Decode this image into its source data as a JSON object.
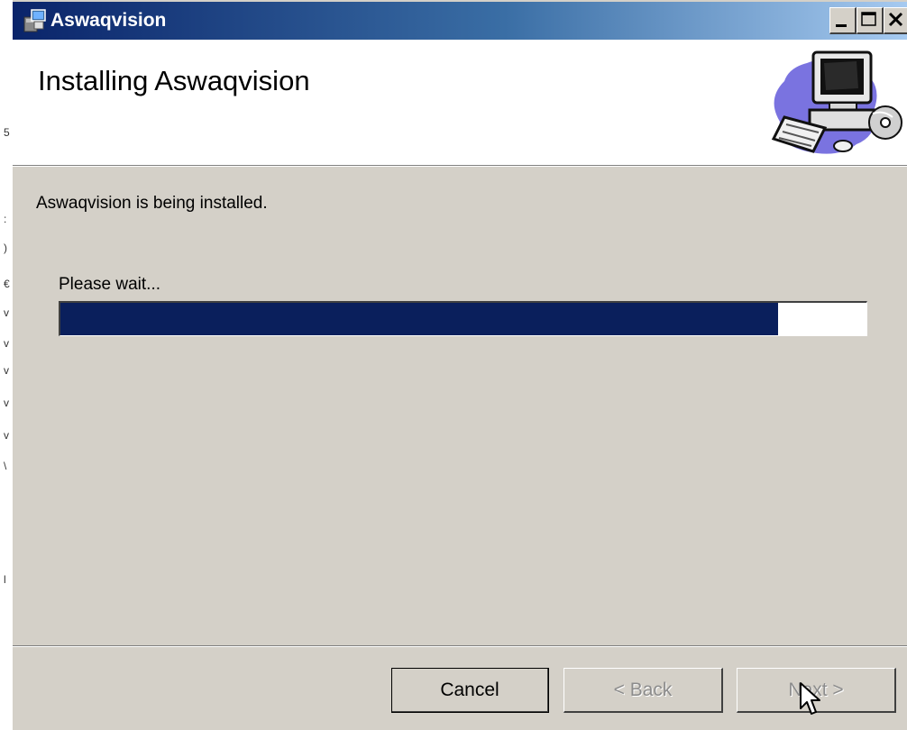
{
  "window": {
    "title": "Aswaqvision"
  },
  "header": {
    "title": "Installing Aswaqvision"
  },
  "main": {
    "status_text": "Aswaqvision is being installed.",
    "wait_text": "Please wait...",
    "progress_percent": 89
  },
  "buttons": {
    "cancel": "Cancel",
    "back": "< Back",
    "next": "Next >"
  },
  "icons": {
    "app": "installer-icon",
    "header": "computer-setup-graphic",
    "minimize": "minimize-icon",
    "maximize": "maximize-icon",
    "close": "close-icon",
    "cursor": "mouse-pointer-icon"
  },
  "colors": {
    "title_bar_start": "#0a246a",
    "title_bar_end": "#a6caf0",
    "progress_fill": "#0a1f5c",
    "dialog_background": "#d4d0c8"
  }
}
